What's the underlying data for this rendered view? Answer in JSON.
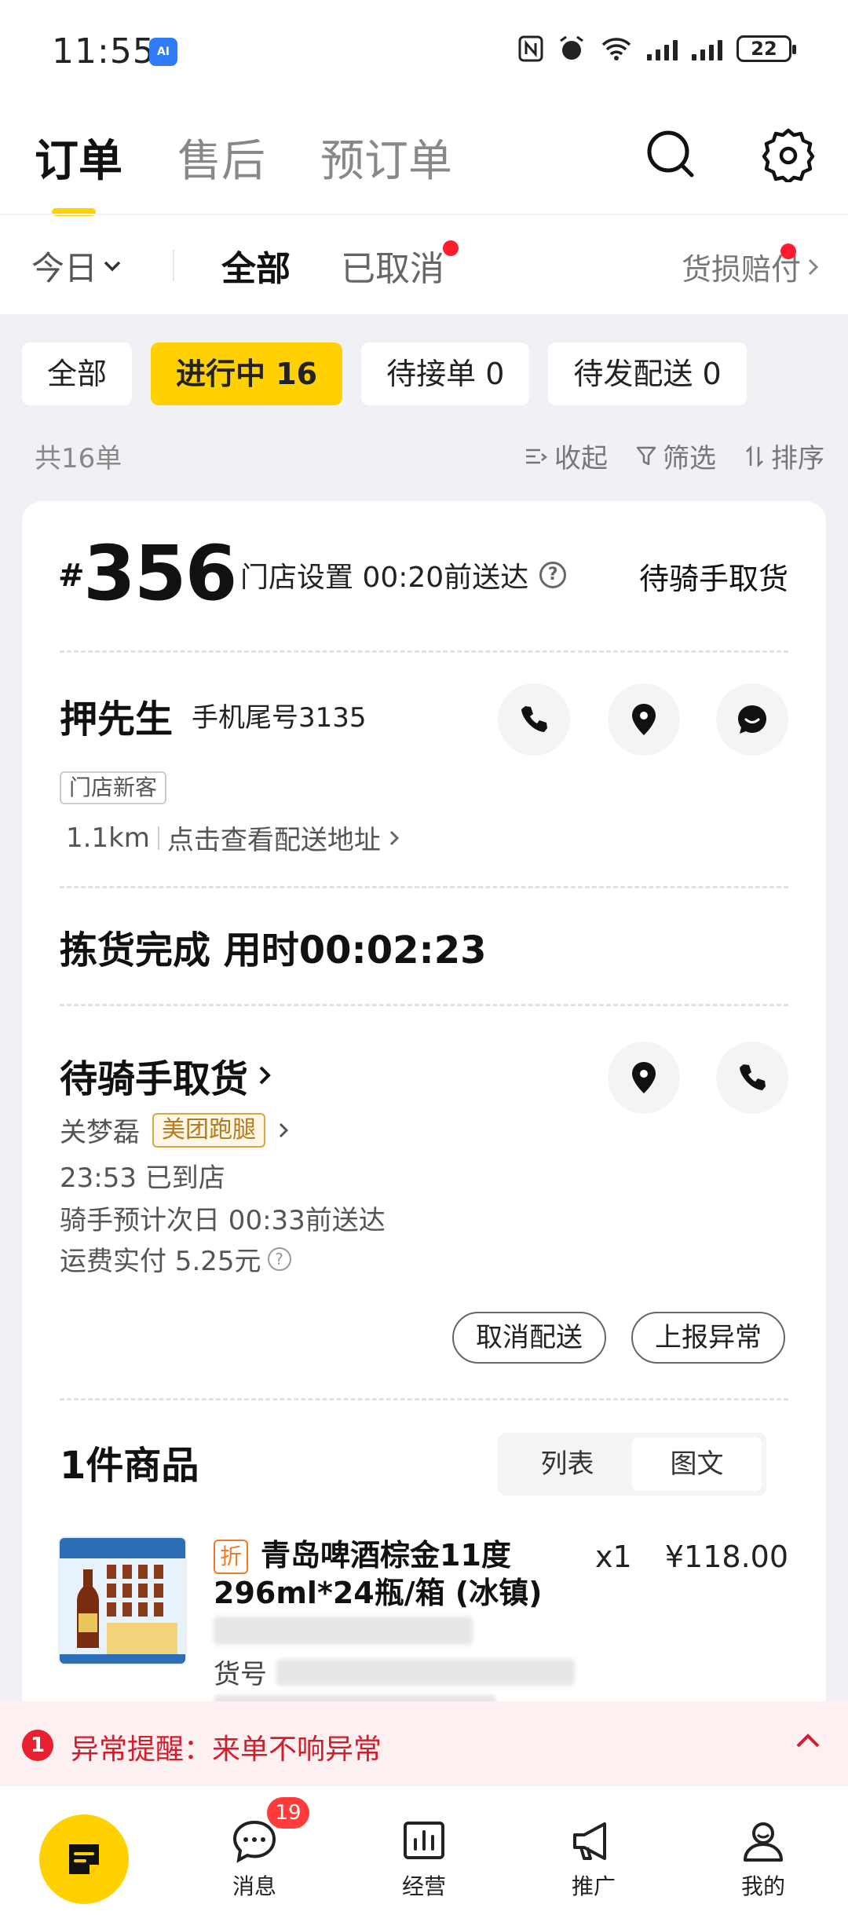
{
  "status_bar": {
    "time": "11:55",
    "ai_badge": "AI",
    "battery": "22"
  },
  "main_tabs": [
    {
      "label": "订单",
      "active": true
    },
    {
      "label": "售后",
      "active": false
    },
    {
      "label": "预订单",
      "active": false
    }
  ],
  "sub_bar": {
    "date_filter": "今日",
    "tabs": [
      {
        "label": "全部",
        "active": true
      },
      {
        "label": "已取消",
        "active": false,
        "has_dot": true
      }
    ],
    "damage_link": "货损赔付"
  },
  "chips": [
    {
      "label": "全部",
      "active": false
    },
    {
      "label": "进行中 16",
      "active": true
    },
    {
      "label": "待接单 0",
      "active": false
    },
    {
      "label": "待发配送 0",
      "active": false
    }
  ],
  "list_meta": {
    "count": "共16单",
    "collapse": "收起",
    "filter": "筛选",
    "sort": "排序"
  },
  "order": {
    "hash": "#",
    "number": "356",
    "deliver_time": "门店设置 00:20前送达",
    "status": "待骑手取货",
    "customer": {
      "name": "押先生",
      "phone": "手机尾号3135",
      "tag": "门店新客",
      "distance": "1.1km",
      "address_link": "点击查看配送地址"
    },
    "pick": "拣货完成 用时00:02:23",
    "rider": {
      "title": "待骑手取货",
      "name": "关梦磊",
      "platform": "美团跑腿",
      "arrived": "23:53  已到店",
      "eta": "骑手预计次日 00:33前送达",
      "fee": "运费实付 5.25元",
      "cancel_btn": "取消配送",
      "report_btn": "上报异常"
    },
    "goods": {
      "title": "1件商品",
      "view_list": "列表",
      "view_graphic": "图文",
      "items": [
        {
          "discount_tag": "折",
          "name": "青岛啤酒棕金11度296ml*24瓶/箱 (冰镇)",
          "qty": "x1",
          "price": "¥118.00",
          "sku_label": "货号"
        }
      ]
    }
  },
  "alert": {
    "num": "1",
    "text": "异常提醒：来单不响异常"
  },
  "bottom_nav": {
    "items": [
      {
        "label": "消息",
        "icon": "message-icon",
        "badge": "19"
      },
      {
        "label": "经营",
        "icon": "chart-icon"
      },
      {
        "label": "推广",
        "icon": "megaphone-icon"
      },
      {
        "label": "我的",
        "icon": "user-icon"
      }
    ]
  },
  "colors": {
    "accent": "#ffd100",
    "alert": "#e8202f",
    "tag_orange": "#f07a28"
  }
}
